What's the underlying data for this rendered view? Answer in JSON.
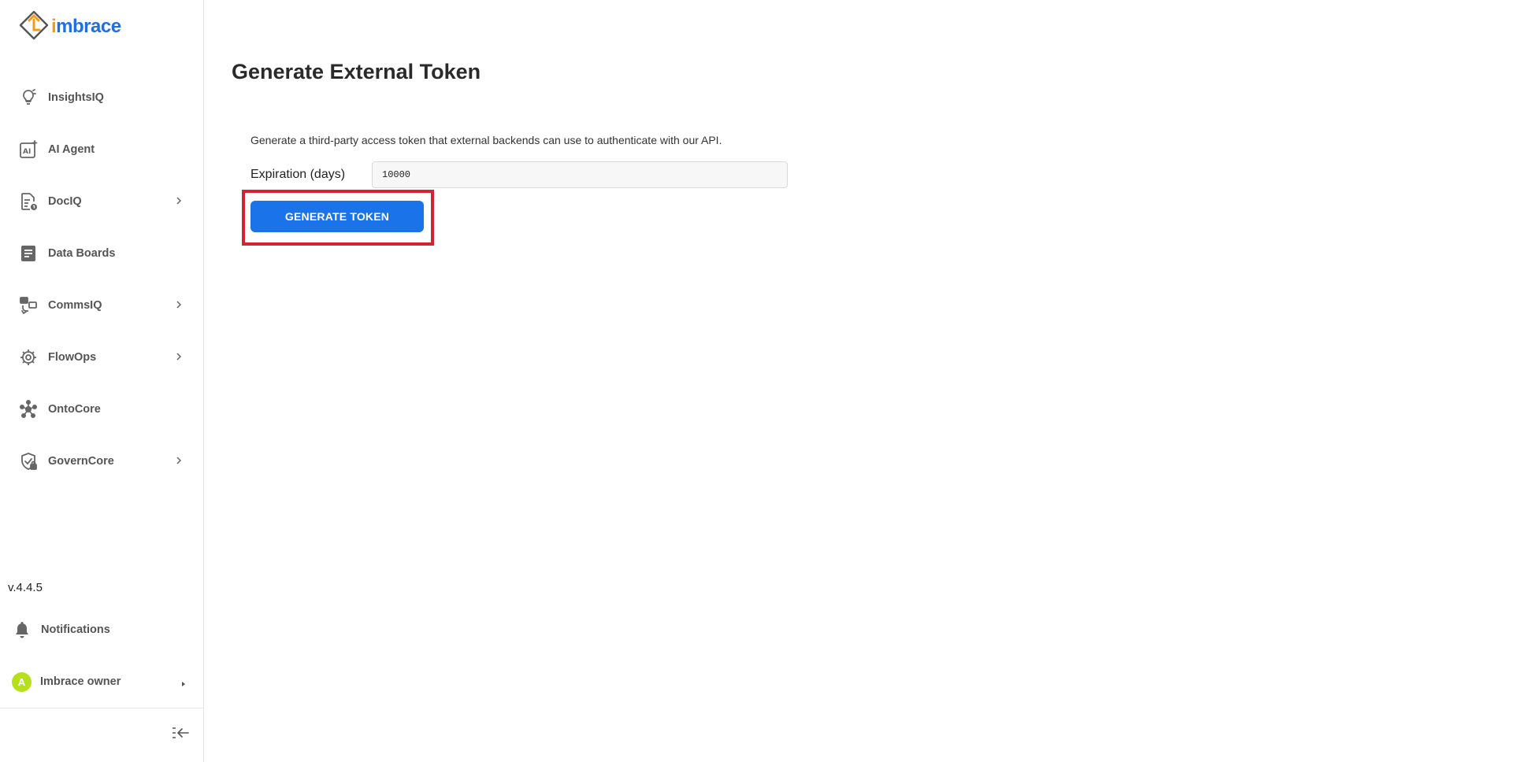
{
  "brand": {
    "logo_first_letter": "i",
    "logo_rest": "mbrace"
  },
  "sidebar": {
    "items": [
      {
        "label": "InsightsIQ",
        "icon": "insights-bulb-icon",
        "has_chevron": false
      },
      {
        "label": "AI Agent",
        "icon": "ai-agent-icon",
        "has_chevron": false
      },
      {
        "label": "DocIQ",
        "icon": "document-icon",
        "has_chevron": true
      },
      {
        "label": "Data Boards",
        "icon": "data-boards-icon",
        "has_chevron": false
      },
      {
        "label": "CommsIQ",
        "icon": "comms-icon",
        "has_chevron": true
      },
      {
        "label": "FlowOps",
        "icon": "flow-gear-icon",
        "has_chevron": true
      },
      {
        "label": "OntoCore",
        "icon": "ontology-network-icon",
        "has_chevron": false
      },
      {
        "label": "GovernCore",
        "icon": "shield-lock-icon",
        "has_chevron": true
      }
    ],
    "version": "v.4.4.5",
    "notifications_label": "Notifications",
    "user": {
      "avatar_letter": "A",
      "name": "Imbrace owner"
    }
  },
  "main": {
    "title": "Generate External Token",
    "description": "Generate a third-party access token that external backends can use to authenticate with our API.",
    "expiration_label": "Expiration (days)",
    "expiration_value": "10000",
    "generate_button_label": "GENERATE TOKEN"
  },
  "colors": {
    "primary": "#1a73e8",
    "highlight": "#d32530",
    "avatar": "#b6e01c",
    "logo_blue": "#1f6fe0",
    "logo_orange": "#f29a1b"
  }
}
